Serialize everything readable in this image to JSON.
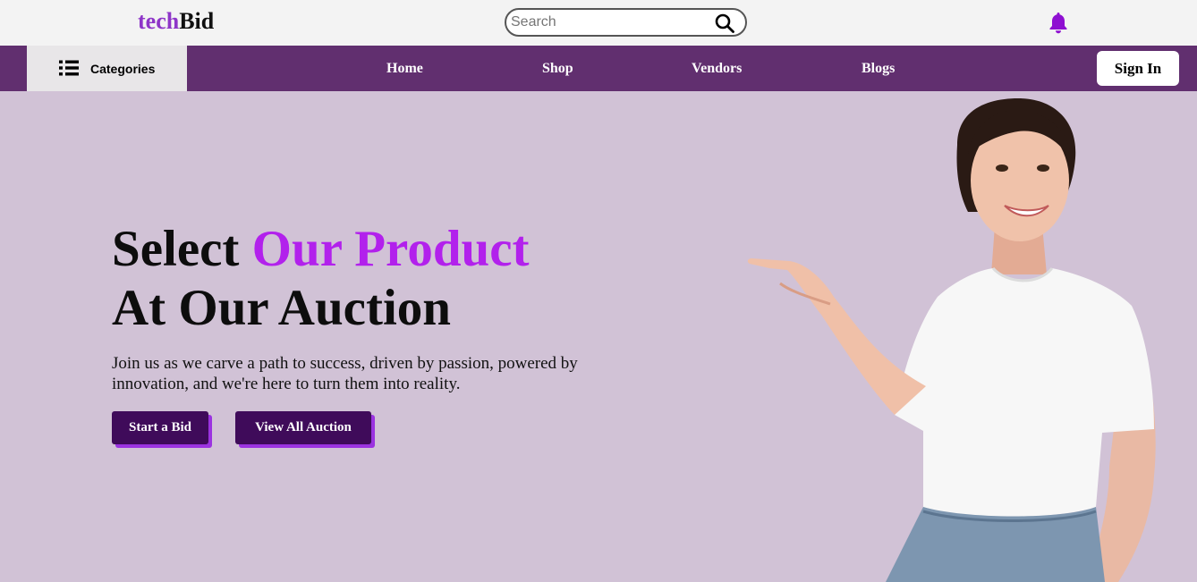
{
  "brand": {
    "part1": "tech",
    "part2": "Bid"
  },
  "search": {
    "placeholder": "Search"
  },
  "nav": {
    "categories_label": "Categories",
    "links": [
      "Home",
      "Shop",
      "Vendors",
      "Blogs"
    ],
    "signin_label": "Sign In"
  },
  "hero": {
    "headline_word1": "Select",
    "headline_accent": "Our Product",
    "headline_line2": "At Our Auction",
    "lead": "Join us as we carve a path to success, driven by passion, powered by innovation, and we're here to turn them into reality.",
    "primary_button": "Start a Bid",
    "secondary_button": "View All Auction"
  },
  "colors": {
    "brand_purple": "#8e35c8",
    "nav_bg": "#612f6f",
    "hero_bg": "#d1c2d6",
    "accent": "#b221ec",
    "button_bg": "#3f0b5a",
    "button_shadow": "#9b33e0"
  },
  "icons": [
    "search-icon",
    "bell-icon",
    "list-icon"
  ]
}
